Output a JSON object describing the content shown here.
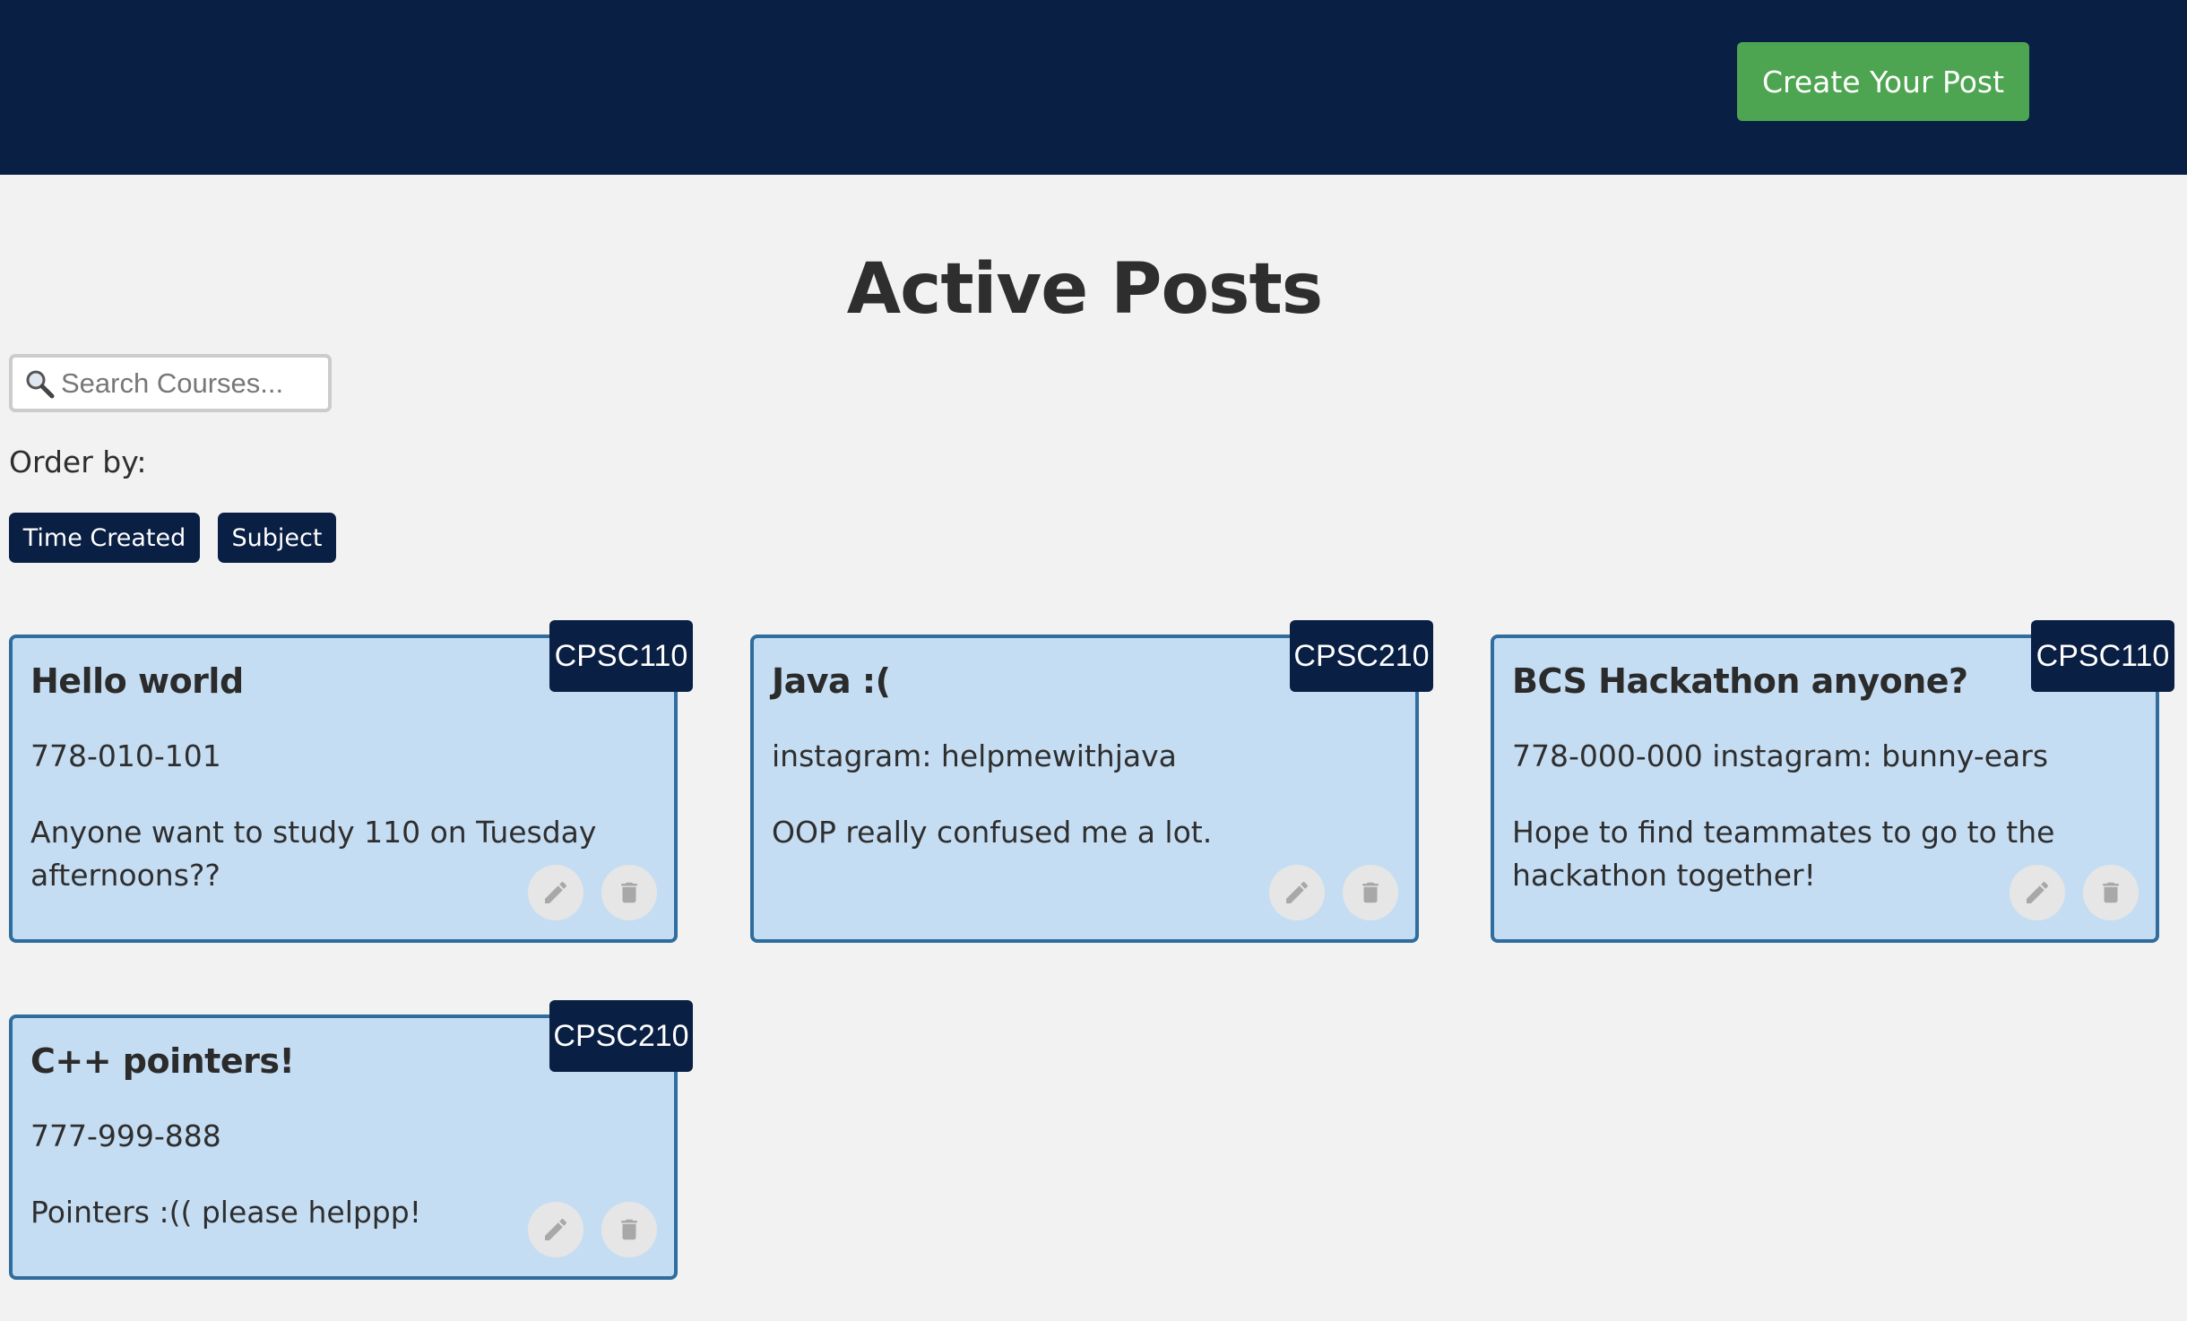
{
  "header": {
    "create_button_label": "Create Your Post"
  },
  "page": {
    "title": "Active Posts"
  },
  "search": {
    "placeholder": "Search Courses..."
  },
  "sort": {
    "label": "Order by:",
    "options": [
      "Time Created",
      "Subject"
    ]
  },
  "posts": [
    {
      "title": "Hello world",
      "course": "CPSC110",
      "contact": "778-010-101",
      "body": "Anyone want to study 110 on Tuesday afternoons??"
    },
    {
      "title": "Java :(",
      "course": "CPSC210",
      "contact": "instagram: helpmewithjava",
      "body": "OOP really confused me a lot."
    },
    {
      "title": "BCS Hackathon anyone?",
      "course": "CPSC110",
      "contact": "778-000-000 instagram: bunny-ears",
      "body": "Hope to find teammates to go to the hackathon together!"
    },
    {
      "title": "C++ pointers!",
      "course": "CPSC210",
      "contact": "777-999-888",
      "body": "Pointers :(( please helppp!"
    }
  ],
  "icons": {
    "search": "magnifier-icon",
    "edit": "pencil-icon",
    "delete": "trash-icon"
  },
  "colors": {
    "header_bg": "#0a1f44",
    "create_button": "#4da551",
    "card_bg": "#c5ddf3",
    "card_border": "#2f6d9e",
    "tag_bg": "#0a1f44",
    "page_bg": "#f2f2f2"
  }
}
